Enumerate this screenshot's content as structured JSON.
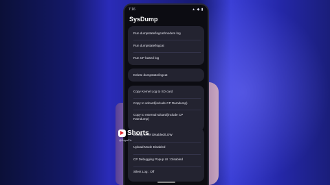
{
  "status_bar": {
    "time": "7:16",
    "icons": "▲ ◆ ▮"
  },
  "app_title": "SysDump",
  "groups": [
    [
      "Run dumpstate/logcat/modem log",
      "Run dumpstate/logcat",
      "Run CP based log"
    ],
    [
      "Delete dumpstate/logcat"
    ],
    [
      "Copy Kernel Log to SD card",
      "Copy to sdcard(include CP Ramdump)",
      "Copy to external sdcard(include CP Ramdump)"
    ],
    [
      "Debug Level Disabled/LOW",
      "Upload Mode Disabled",
      "CP Debugging Popup UI : Disabled",
      "Silent Log : Off"
    ]
  ],
  "overlay": {
    "brand": "Shorts",
    "handle": "@AppsFix"
  },
  "colors": {
    "card": "#232330",
    "screen": "#0c0c12",
    "background_blue": "#2a2bb8",
    "shorts_red": "#e2232a"
  }
}
